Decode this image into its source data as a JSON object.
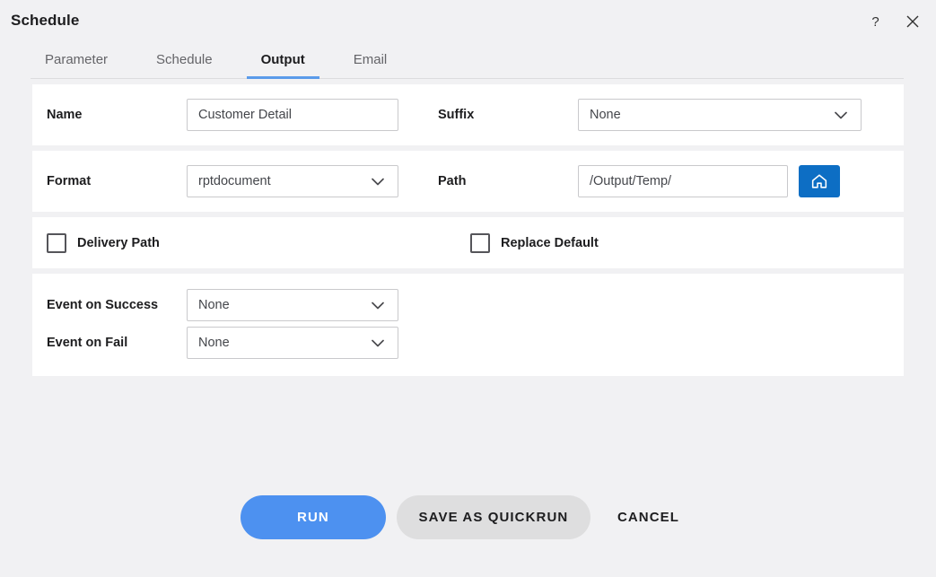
{
  "window": {
    "title": "Schedule",
    "help_icon": "question-mark-icon",
    "close_icon": "close-icon"
  },
  "tabs": [
    {
      "label": "Parameter",
      "active": false
    },
    {
      "label": "Schedule",
      "active": false
    },
    {
      "label": "Output",
      "active": true
    },
    {
      "label": "Email",
      "active": false
    }
  ],
  "form": {
    "name": {
      "label": "Name",
      "value": "Customer Detail",
      "placeholder": "Customer Detail"
    },
    "suffix": {
      "label": "Suffix",
      "value": "None",
      "icon": "chevron-down-icon"
    },
    "format": {
      "label": "Format",
      "value": "rptdocument",
      "icon": "chevron-down-icon"
    },
    "path": {
      "label": "Path",
      "value": "/Output/Temp/",
      "placeholder": "/Output/Temp/",
      "home_button_icon": "home-icon"
    },
    "delivery_path": {
      "label": "Delivery Path",
      "checked": false
    },
    "replace_default": {
      "label": "Replace Default",
      "checked": false
    },
    "event_on_success": {
      "label": "Event on Success",
      "value": "None",
      "icon": "chevron-down-icon"
    },
    "event_on_fail": {
      "label": "Event on Fail",
      "value": "None",
      "icon": "chevron-down-icon"
    }
  },
  "footer": {
    "run_label": "RUN",
    "save_label": "SAVE AS QUICKRUN",
    "cancel_label": "CANCEL"
  },
  "colors": {
    "accent_blue": "#4d91f0",
    "tab_underline": "#5a9bea",
    "home_button": "#0d6ec4",
    "page_background": "#f1f1f3",
    "card_background": "#ffffff"
  }
}
